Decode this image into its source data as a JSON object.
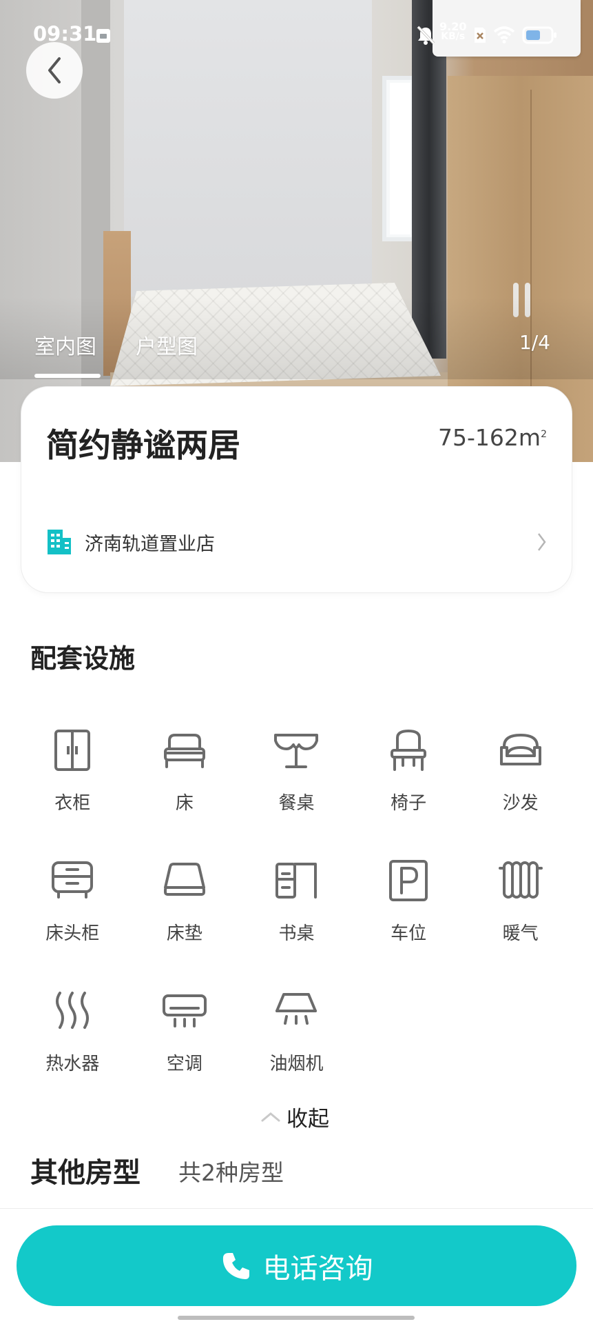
{
  "status_bar": {
    "time": "09:31",
    "net_speed_value": "9.20",
    "net_speed_unit": "KB/s",
    "icons": [
      "sim-card-icon",
      "bell-muted-icon",
      "sim-off-icon",
      "wifi-icon",
      "battery-icon"
    ]
  },
  "gallery": {
    "tabs": [
      {
        "label": "室内图",
        "active": true
      },
      {
        "label": "户型图",
        "active": false
      }
    ],
    "counter": "1/4"
  },
  "listing": {
    "title": "简约静谧两居",
    "area": "75-162m",
    "area_sup": "2",
    "store": "济南轨道置业店"
  },
  "facilities": {
    "title": "配套设施",
    "items": [
      {
        "label": "衣柜",
        "icon": "wardrobe-icon"
      },
      {
        "label": "床",
        "icon": "bed-icon"
      },
      {
        "label": "餐桌",
        "icon": "dining-table-icon"
      },
      {
        "label": "椅子",
        "icon": "chair-icon"
      },
      {
        "label": "沙发",
        "icon": "sofa-icon"
      },
      {
        "label": "床头柜",
        "icon": "nightstand-icon"
      },
      {
        "label": "床垫",
        "icon": "mattress-icon"
      },
      {
        "label": "书桌",
        "icon": "desk-icon"
      },
      {
        "label": "车位",
        "icon": "parking-icon"
      },
      {
        "label": "暖气",
        "icon": "radiator-icon"
      },
      {
        "label": "热水器",
        "icon": "water-heater-icon"
      },
      {
        "label": "空调",
        "icon": "air-conditioner-icon"
      },
      {
        "label": "油烟机",
        "icon": "range-hood-icon"
      }
    ],
    "collapse_label": "收起"
  },
  "other_types": {
    "title": "其他房型",
    "count": "共2种房型"
  },
  "cta": {
    "call_label": "电话咨询"
  },
  "colors": {
    "accent": "#13c9c9",
    "icon_stroke": "#6b6b6b",
    "store_icon": "#13c0c6"
  }
}
